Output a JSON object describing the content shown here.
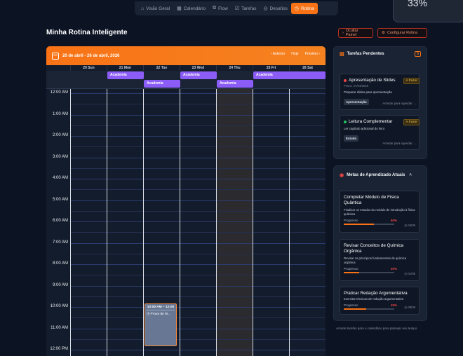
{
  "nav": {
    "tabs": [
      {
        "label": "Visão Geral",
        "icon": "home-icon",
        "glyph": "⌂"
      },
      {
        "label": "Calendário",
        "icon": "calendar-icon",
        "glyph": "▦"
      },
      {
        "label": "Flow",
        "icon": "flow-icon",
        "glyph": "⧉"
      },
      {
        "label": "Tarefas",
        "icon": "checklist-icon",
        "glyph": "☑"
      },
      {
        "label": "Desafios",
        "icon": "target-icon",
        "glyph": "◎"
      },
      {
        "label": "Rotina",
        "icon": "clock-icon",
        "glyph": "◷",
        "active": true
      }
    ]
  },
  "corner_badge": "33%",
  "page": {
    "title": "Minha Rotina Inteligente",
    "btn_hide": "Ocultar Painel",
    "btn_config": "Configurar Rotina"
  },
  "calendar": {
    "range": "20 de abril - 26 de abril, 2026",
    "nav_prev": "Anterior",
    "nav_today": "Hoje",
    "nav_next": "Próximo",
    "days": [
      "20 Sun",
      "21 Mon",
      "22 Tue",
      "23 Wed",
      "24 Thu",
      "25 Fri",
      "26 Sat"
    ],
    "times": [
      "12:00 AM",
      "1:00 AM",
      "2:00 AM",
      "3:00 AM",
      "4:00 AM",
      "5:00 AM",
      "6:00 AM",
      "7:00 AM",
      "8:00 AM",
      "9:00 AM",
      "10:00 AM",
      "11:00 AM",
      "12:00 PM"
    ],
    "allday_events": [
      {
        "label": "Academia"
      },
      {
        "label": "Academia"
      },
      {
        "label": "Academia"
      },
      {
        "label": "Academia"
      },
      {
        "label": "Academia"
      }
    ],
    "event_block": {
      "time": "10:00 AM – 12:00",
      "name": "◷ Prova de M..."
    }
  },
  "tasks_panel": {
    "title": "Tarefas Pendentes",
    "count": "5",
    "tasks": [
      {
        "title": "Apresentação de Slides",
        "status": "A Fazer",
        "due": "Prazo: 27/04/2026",
        "desc": "Preparar slides para apresentação",
        "tag": "Apresentação",
        "drag": "Arrastar para Agendar →",
        "color": "#ef4444"
      },
      {
        "title": "Leitura Complementar",
        "status": "A Fazer",
        "due": "",
        "desc": "Ler capítulo adicional do livro",
        "tag": "Estudo",
        "drag": "Arrastar para Agendar →",
        "color": "#22c55e"
      }
    ]
  },
  "goals_panel": {
    "title": "Metas de Aprendizado Atuais",
    "goals": [
      {
        "title": "Completar Módulo de Física Quântica",
        "desc": "Finalizar os estudos do módulo de introdução à física quântica",
        "progress_label": "Progresso",
        "pct": "60%",
        "value": 0.6,
        "date": "◷ 04/05"
      },
      {
        "title": "Revisar Conceitos de Química Orgânica",
        "desc": "Revisar os princípios fundamentais de química orgânica",
        "progress_label": "Progresso",
        "pct": "30%",
        "value": 0.3,
        "date": "◷ 01/05"
      },
      {
        "title": "Praticar Redação Argumentativa",
        "desc": "Exercitar técnicas de redação argumentativa",
        "progress_label": "Progresso",
        "pct": "45%",
        "value": 0.45,
        "date": "◷ 08/05"
      }
    ]
  },
  "footnote": "Arraste tarefas para o calendário para planejar seu tempo"
}
